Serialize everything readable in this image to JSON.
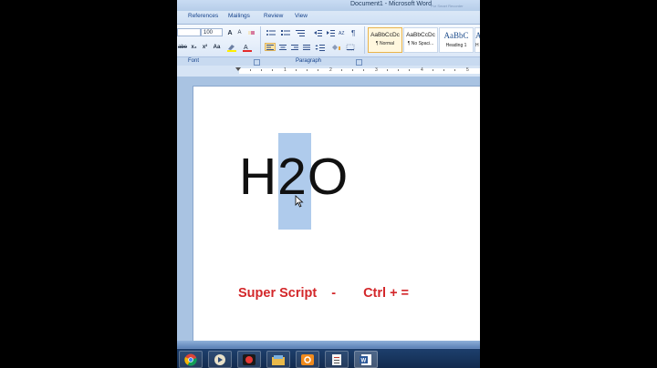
{
  "window": {
    "title_doc": "Document1",
    "title_app": "Microsoft Word",
    "title_sep": "-",
    "ghost_text": "Pur Smart Recorder"
  },
  "ribbon_tabs": [
    "References",
    "Mailings",
    "Review",
    "View"
  ],
  "font_group": {
    "label": "Font",
    "font_size": "100",
    "grow_label": "A",
    "shrink_label": "A",
    "style_buttons": [
      "abe",
      "x₂",
      "x²",
      "Aa"
    ]
  },
  "paragraph_group": {
    "label": "Paragraph"
  },
  "styles": [
    {
      "sample": "AaBbCcDc",
      "name": "¶ Normal"
    },
    {
      "sample": "AaBbCcDc",
      "name": "¶ No Spaci..."
    },
    {
      "sample": "AaBbC",
      "name": "Heading 1"
    },
    {
      "sample": "A",
      "name": "H"
    }
  ],
  "ruler": {
    "numbers": [
      "1",
      "2",
      "3",
      "4",
      "5"
    ]
  },
  "document": {
    "formula_h": "H",
    "formula_2": "2",
    "formula_o": "O",
    "caption_label": "Super Script",
    "caption_dash": "-",
    "caption_shortcut": "Ctrl + ="
  },
  "colors": {
    "caption_red": "#d3272a",
    "selection_blue": "#6ea0dc",
    "ribbon_blue": "#dfeaf8"
  },
  "taskbar": {
    "icons": [
      "chrome-icon",
      "media-player-icon",
      "recorder-icon",
      "folder-icon",
      "app-orange-icon",
      "notepad-icon",
      "word-icon"
    ]
  }
}
